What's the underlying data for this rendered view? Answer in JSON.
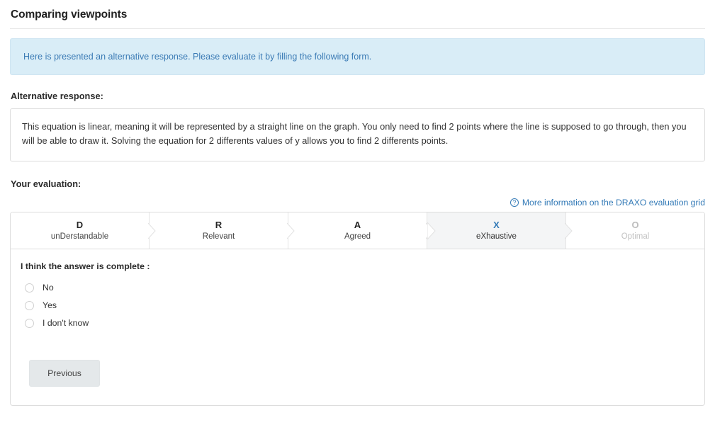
{
  "header": {
    "title": "Comparing viewpoints"
  },
  "alert": {
    "icon": "info-icon",
    "message": "Here is presented an alternative response. Please evaluate it by filling the following form."
  },
  "alternative_response": {
    "label": "Alternative response:",
    "text": "This equation is linear, meaning it will be represented by a straight line on the graph. You only need to find 2 points where the line is supposed to go through, then you will be able to draw it. Solving the equation for 2 differents values of y allows you to find 2 differents points."
  },
  "evaluation": {
    "label": "Your evaluation:",
    "more_info": {
      "icon": "help-circle-icon",
      "label": "More information on the DRAXO evaluation grid"
    },
    "steps": [
      {
        "letter": "D",
        "name": "unDerstandable",
        "state": "done"
      },
      {
        "letter": "R",
        "name": "Relevant",
        "state": "done"
      },
      {
        "letter": "A",
        "name": "Agreed",
        "state": "done"
      },
      {
        "letter": "X",
        "name": "eXhaustive",
        "state": "active"
      },
      {
        "letter": "O",
        "name": "Optimal",
        "state": "disabled"
      }
    ],
    "question": "I think the answer is complete :",
    "options": [
      {
        "label": "No",
        "selected": false
      },
      {
        "label": "Yes",
        "selected": false
      },
      {
        "label": "I don't know",
        "selected": false
      }
    ],
    "previous_label": "Previous"
  },
  "colors": {
    "link": "#337ab7",
    "alert_bg": "#d9edf7",
    "alert_text": "#3b7bb5",
    "active_step_bg": "#f4f5f6",
    "button_bg": "#e4e8ea",
    "disabled_text": "#c2c2c2"
  }
}
